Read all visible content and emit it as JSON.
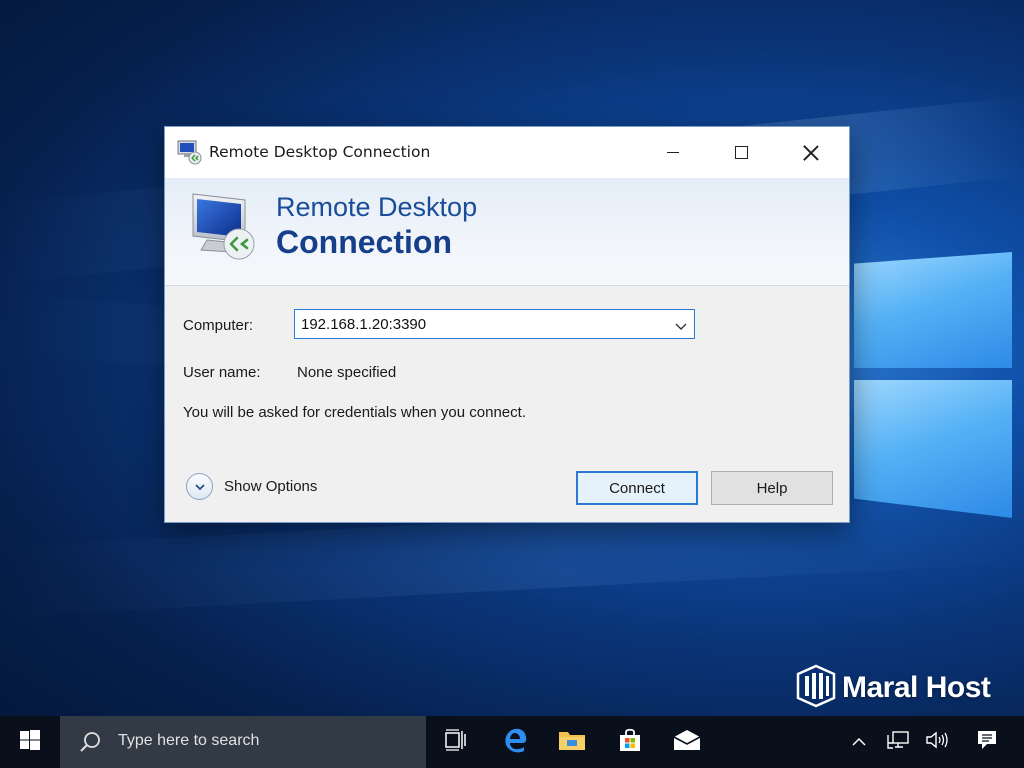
{
  "window": {
    "title": "Remote Desktop Connection",
    "banner_line1": "Remote Desktop",
    "banner_line2": "Connection"
  },
  "form": {
    "computer_label": "Computer:",
    "computer_value": "192.168.1.20:3390",
    "username_label": "User name:",
    "username_value": "None specified",
    "info_text": "You will be asked for credentials when you connect."
  },
  "buttons": {
    "show_options": "Show Options",
    "connect": "Connect",
    "help": "Help"
  },
  "watermark": {
    "brand": "Maral Host"
  },
  "taskbar": {
    "search_placeholder": "Type here to search",
    "pinned_icons": [
      "task-view-icon",
      "edge-icon",
      "file-explorer-icon",
      "store-icon",
      "mail-icon"
    ],
    "tray_icons": [
      "chevron-up-icon",
      "network-icon",
      "volume-icon",
      "notifications-icon"
    ]
  },
  "colors": {
    "accent": "#2a79d4",
    "banner_text": "#1a4d99",
    "taskbar": "#0a0f1c"
  }
}
